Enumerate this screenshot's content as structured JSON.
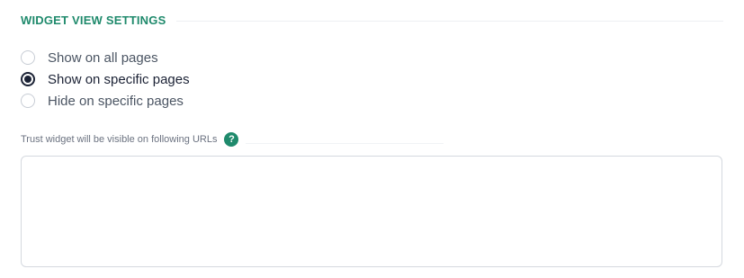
{
  "section": {
    "title": "WIDGET VIEW SETTINGS"
  },
  "view_options": [
    {
      "label": "Show on all pages",
      "checked": false
    },
    {
      "label": "Show on specific pages",
      "checked": true
    },
    {
      "label": "Hide on specific pages",
      "checked": false
    }
  ],
  "urls_field": {
    "label": "Trust widget will be visible on following URLs",
    "help_icon_glyph": "?",
    "value": "",
    "placeholder": ""
  },
  "colors": {
    "accent_green": "#1f8a6c",
    "radio_selected": "#1b2235"
  },
  "icons": {
    "help": "question-mark-circle-icon"
  }
}
